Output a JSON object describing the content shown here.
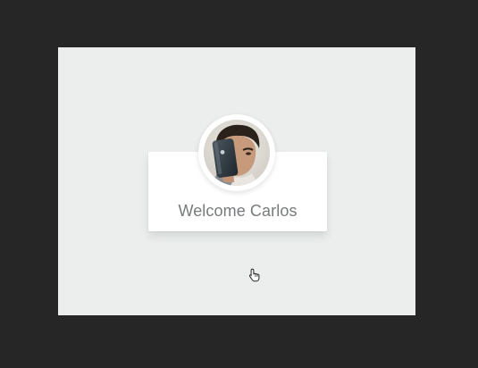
{
  "login": {
    "welcome_text": "Welcome Carlos"
  },
  "icons": {
    "avatar": "user-avatar-photo",
    "cursor": "hand-pointer-icon"
  },
  "colors": {
    "background": "#262626",
    "screen": "#ebeeed",
    "card": "#ffffff",
    "text": "#777b7c"
  }
}
